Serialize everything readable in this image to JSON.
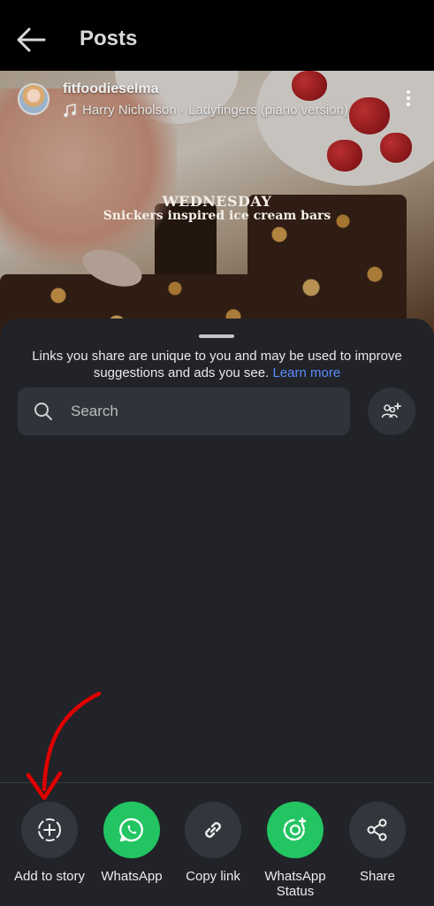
{
  "header": {
    "title": "Posts"
  },
  "post": {
    "username": "fitfoodieselma",
    "music": "Harry Nicholson · Ladyfingers (piano version)",
    "overlay_day": "WEDNESDAY",
    "overlay_caption": "Snickers inspired ice cream bars"
  },
  "sheet": {
    "notice_text": "Links you share are unique to you and may be used to improve suggestions and ads you see.",
    "learn_more": "Learn more",
    "search_placeholder": "Search"
  },
  "share_targets": [
    {
      "label": "Add to story",
      "icon": "add-story-icon"
    },
    {
      "label": "WhatsApp",
      "icon": "whatsapp-icon"
    },
    {
      "label": "Copy link",
      "icon": "link-icon"
    },
    {
      "label": "WhatsApp Status",
      "icon": "whatsapp-status-icon"
    },
    {
      "label": "Share",
      "icon": "share-icon"
    }
  ],
  "colors": {
    "sheet_bg": "#212328",
    "whatsapp_green": "#23c462",
    "link_blue": "#5b8cff",
    "annotation_red": "#e00000"
  }
}
